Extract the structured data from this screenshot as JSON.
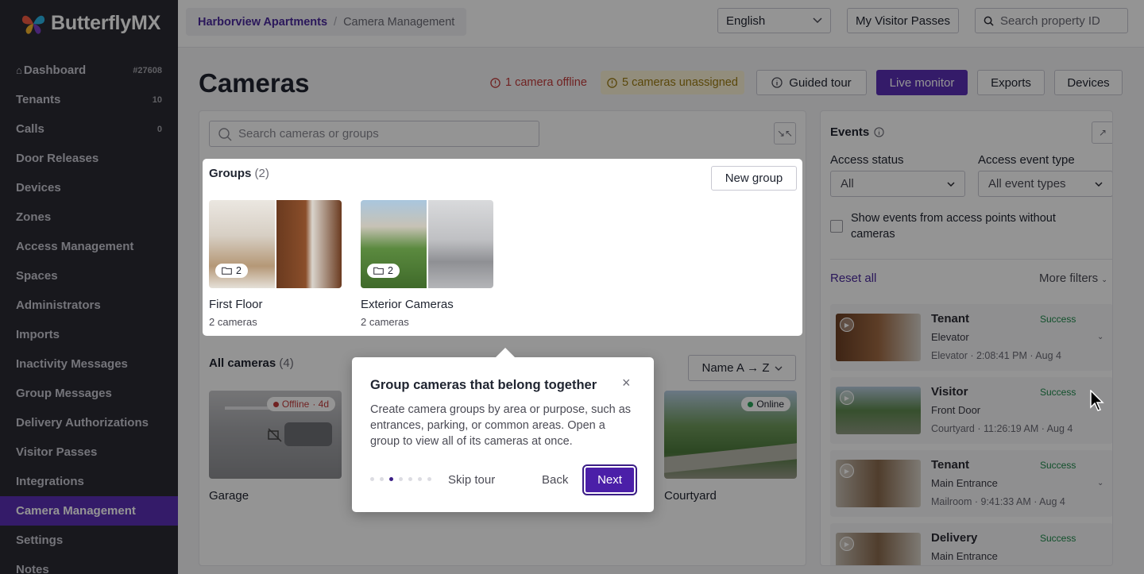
{
  "brand": {
    "name": "ButterflyMX"
  },
  "sidebar": {
    "items": [
      {
        "label": "Dashboard",
        "count": "#27608",
        "icon": "home-icon"
      },
      {
        "label": "Tenants",
        "count": "10"
      },
      {
        "label": "Calls",
        "count": "0"
      },
      {
        "label": "Door Releases",
        "count": ""
      },
      {
        "label": "Devices",
        "count": ""
      },
      {
        "label": "Zones",
        "count": ""
      },
      {
        "label": "Access Management",
        "count": ""
      },
      {
        "label": "Spaces",
        "count": ""
      },
      {
        "label": "Administrators",
        "count": ""
      },
      {
        "label": "Imports",
        "count": ""
      },
      {
        "label": "Inactivity Messages",
        "count": ""
      },
      {
        "label": "Group Messages",
        "count": ""
      },
      {
        "label": "Delivery Authorizations",
        "count": ""
      },
      {
        "label": "Visitor Passes",
        "count": ""
      },
      {
        "label": "Integrations",
        "count": ""
      },
      {
        "label": "Camera Management",
        "count": "",
        "active": true
      },
      {
        "label": "Settings",
        "count": ""
      },
      {
        "label": "Notes",
        "count": ""
      }
    ]
  },
  "topbar": {
    "breadcrumb": {
      "property": "Harborview Apartments",
      "separator": "/",
      "current": "Camera Management"
    },
    "language": "English",
    "visitor_passes": "My Visitor Passes",
    "search_placeholder": "Search property ID"
  },
  "page": {
    "title": "Cameras",
    "alert_offline": "1 camera offline",
    "alert_unassigned": "5 cameras unassigned",
    "guided_tour": "Guided tour",
    "live_monitor": "Live monitor",
    "exports": "Exports",
    "devices": "Devices"
  },
  "cameras_panel": {
    "search_placeholder": "Search cameras or groups",
    "groups_title": "Groups",
    "groups_count": "(2)",
    "new_group": "New group",
    "groups": [
      {
        "name": "First Floor",
        "count_label": "2 cameras",
        "badge": "2"
      },
      {
        "name": "Exterior Cameras",
        "count_label": "2 cameras",
        "badge": "2"
      }
    ],
    "all_title": "All cameras",
    "all_count": "(4)",
    "sort": "Name A → Z",
    "cameras": [
      {
        "name": "Garage",
        "status": "Offline",
        "status_extra": "· 4d"
      },
      {
        "name": "Courtyard",
        "status": "Online",
        "status_extra": ""
      }
    ]
  },
  "events": {
    "title": "Events",
    "access_status_label": "Access status",
    "access_status_value": "All",
    "event_type_label": "Access event type",
    "event_type_value": "All event types",
    "checkbox_label": "Show events from access points without cameras",
    "reset": "Reset all",
    "more_filters": "More filters",
    "items": [
      {
        "who": "Tenant",
        "where": "Elevator",
        "when": "Elevator · 2:08:41 PM · Aug 4",
        "status": "Success"
      },
      {
        "who": "Visitor",
        "where": "Front Door",
        "when": "Courtyard · 11:26:19 AM · Aug 4",
        "status": "Success"
      },
      {
        "who": "Tenant",
        "where": "Main Entrance",
        "when": "Mailroom · 9:41:33 AM · Aug 4",
        "status": "Success"
      },
      {
        "who": "Delivery",
        "where": "Main Entrance",
        "when": "",
        "status": "Success"
      }
    ]
  },
  "tour": {
    "title": "Group cameras that belong together",
    "body": "Create camera groups by area or purpose, such as entrances, parking, or common areas. Open a group to view all of its cameras at once.",
    "skip": "Skip tour",
    "back": "Back",
    "next": "Next",
    "step": 3,
    "steps": 7
  },
  "colors": {
    "accent": "#5a2fb6",
    "sidebar_bg": "#2a2a33",
    "success": "#1f8a4c",
    "offline": "#c23b3b"
  }
}
